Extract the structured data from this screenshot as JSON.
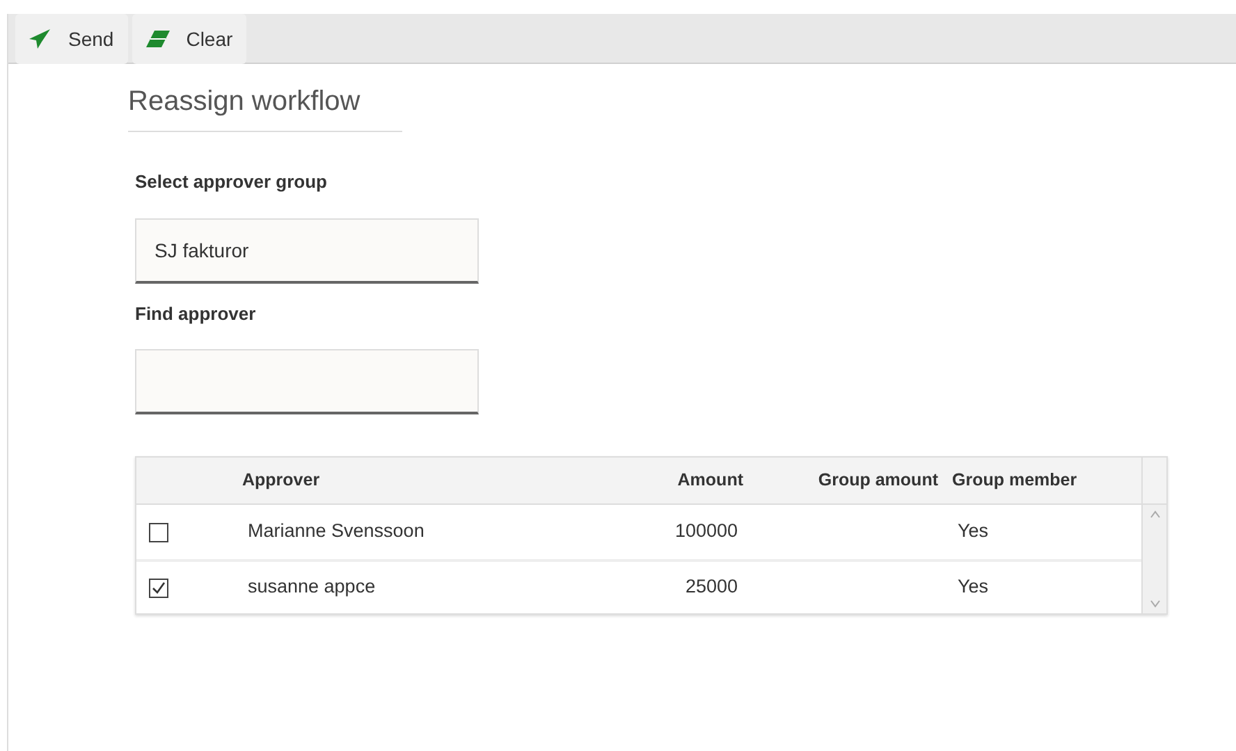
{
  "toolbar": {
    "buttons": [
      {
        "label": "Send",
        "kind": "send"
      },
      {
        "label": "Clear",
        "kind": "clear"
      }
    ]
  },
  "title": "Reassign workflow",
  "fields": [
    {
      "label": "Select approver group",
      "value": "SJ fakturor"
    },
    {
      "label": "Find approver"
    }
  ],
  "table": {
    "columns": [
      "Approver",
      "Amount",
      "Group amount",
      "Group member"
    ],
    "rows": [
      {
        "checked": false,
        "approver": "Marianne Svenssoon",
        "amount": "100000",
        "group_member": "Yes"
      },
      {
        "checked": true,
        "approver": "susanne appce",
        "amount": "25000",
        "group_member": "Yes"
      }
    ]
  }
}
